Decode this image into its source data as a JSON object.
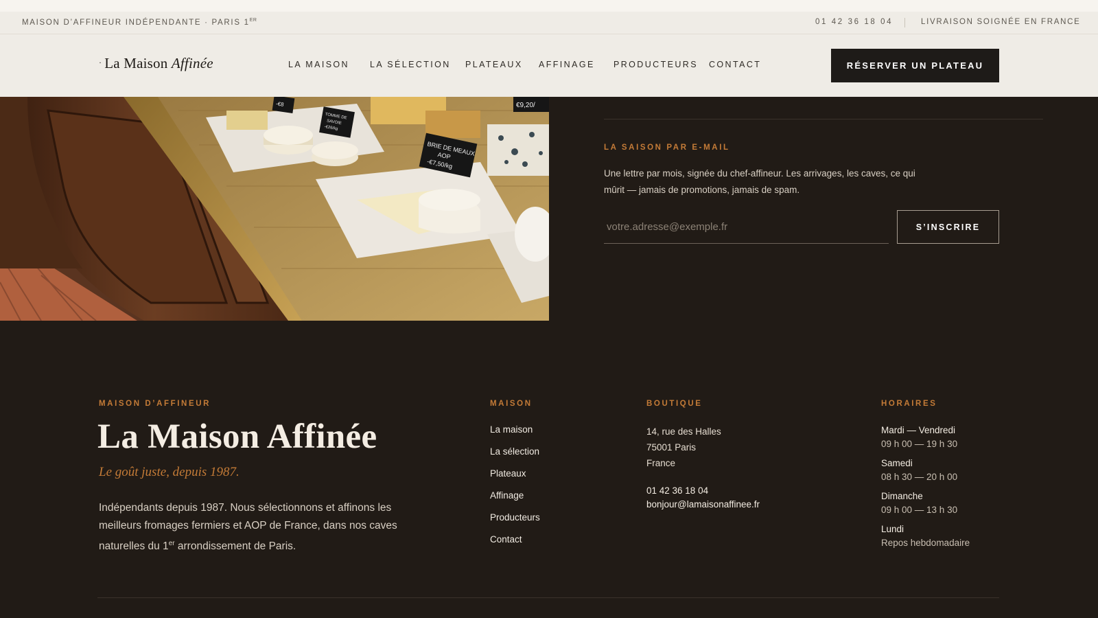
{
  "util_bar": {
    "left_text": "MAISON D’AFFINEUR INDÉPENDANTE · PARIS 1",
    "left_sup": "ER",
    "phone": "01 42 36 18 04",
    "delivery": "LIVRAISON SOIGNÉE EN FRANCE"
  },
  "header": {
    "logo_dot": "·",
    "logo_main": "La Maison ",
    "logo_italic": "Affinée",
    "nav": [
      "LA MAISON",
      "LA SÉLECTION",
      "PLATEAUX",
      "AFFINAGE",
      "PRODUCTEURS",
      "CONTACT"
    ],
    "cta": "RÉSERVER UN PLATEAU"
  },
  "photo": {
    "signs": [
      "BRIE DE MEAUX",
      "AOP",
      "-€7,50/kg",
      "TOMME DE",
      "SAVOIE",
      "-€26/kg",
      "€9,20/",
      "-€8"
    ]
  },
  "newsletter": {
    "eyebrow": "LA SAISON PAR E-MAIL",
    "description": "Une lettre par mois, signée du chef-affineur. Les arrivages, les caves, ce qui mûrit — jamais de promotions, jamais de spam.",
    "placeholder": "votre.adresse@exemple.fr",
    "button": "S’INSCRIRE"
  },
  "footer": {
    "brand": {
      "eyebrow": "MAISON D’AFFINEUR",
      "name": "La Maison Affinée",
      "tagline": "Le goût juste, depuis 1987.",
      "desc_before": "Indépendants depuis 1987. Nous sélectionnons et affinons les meilleurs fromages fermiers et AOP de France, dans nos caves naturelles du 1",
      "desc_sup": "er",
      "desc_after": " arrondissement de Paris."
    },
    "maison": {
      "title": "MAISON",
      "links": [
        "La maison",
        "La sélection",
        "Plateaux",
        "Affinage",
        "Producteurs",
        "Contact"
      ]
    },
    "boutique": {
      "title": "BOUTIQUE",
      "address": [
        "14, rue des Halles",
        "75001 Paris",
        "France"
      ],
      "phone": "01 42 36 18 04",
      "email": "bonjour@lamaisonaffinee.fr"
    },
    "horaires": {
      "title": "HORAIRES",
      "slots": [
        {
          "day": "Mardi — Vendredi",
          "time": "09 h 00 — 19 h 30"
        },
        {
          "day": "Samedi",
          "time": "08 h 30 — 20 h 00"
        },
        {
          "day": "Dimanche",
          "time": "09 h 00 — 13 h 30"
        },
        {
          "day": "Lundi",
          "time": "Repos hebdomadaire"
        }
      ]
    }
  },
  "colors": {
    "accent": "#c47b37",
    "dark_bg": "#211b16",
    "header_bg": "#efece6",
    "cta_bg": "#1e1b18"
  }
}
